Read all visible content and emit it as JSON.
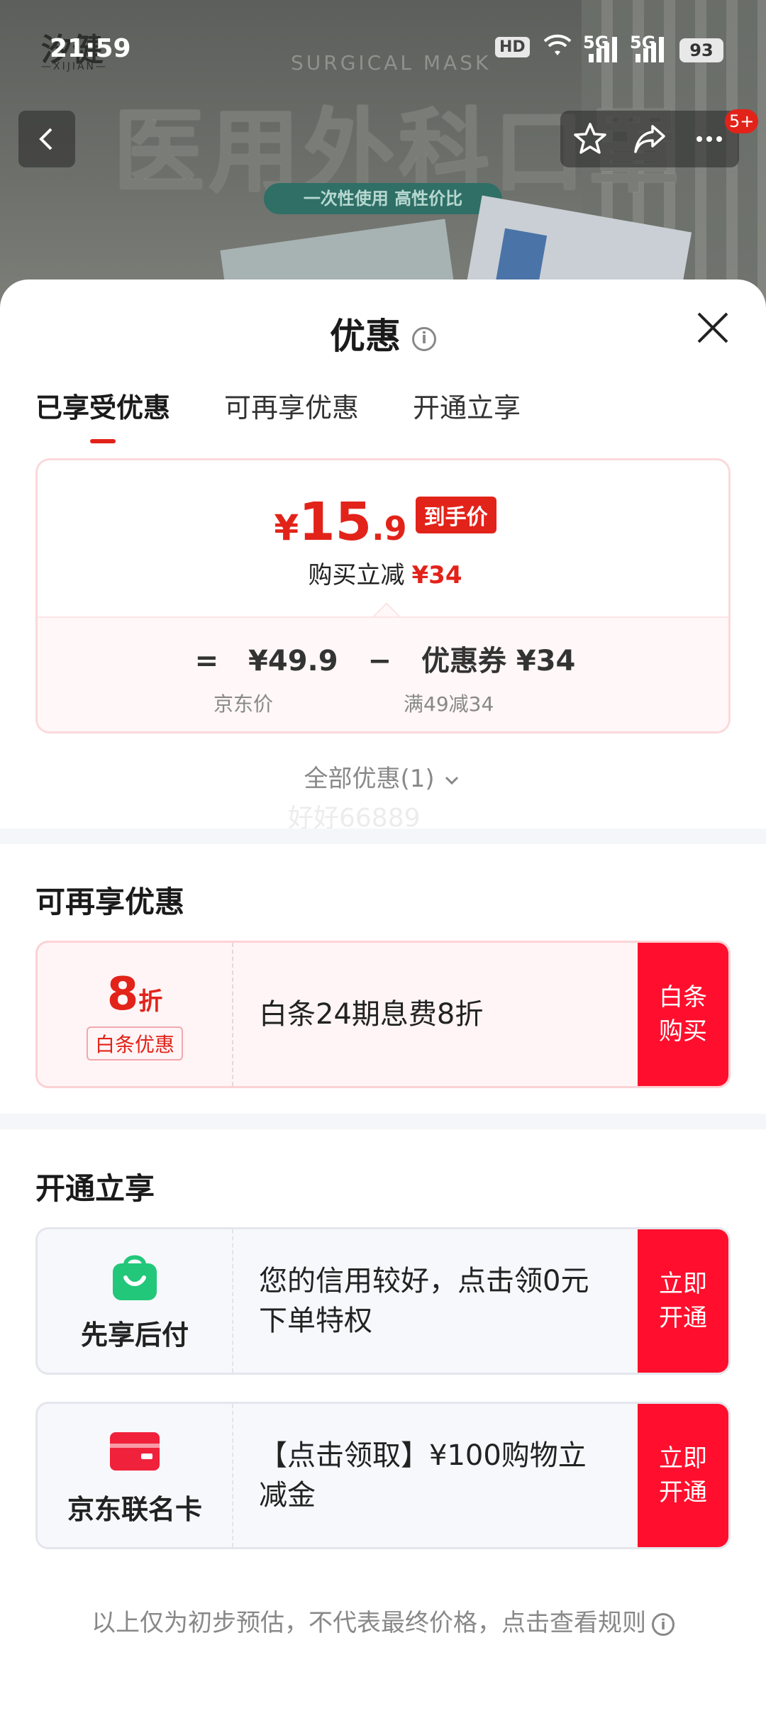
{
  "status_bar": {
    "time": "21:59",
    "hd_label": "HD",
    "signal_1": "5G",
    "signal_2": "5G",
    "battery": "93"
  },
  "banner": {
    "logo": "汐健",
    "logo_sub": "—XIJIAN—",
    "subtitle_en": "SURGICAL MASK",
    "title": "医用外科口罩",
    "pill": "一次性使用 高性价比"
  },
  "nav": {
    "back_icon": "chevron-left-icon",
    "actions": [
      "star-icon",
      "share-icon",
      "more-icon"
    ],
    "badge": "5+"
  },
  "sheet": {
    "title": "优惠",
    "close_icon": "close-icon",
    "tabs": [
      {
        "label": "已享受优惠",
        "active": true
      },
      {
        "label": "可再享优惠",
        "active": false
      },
      {
        "label": "开通立享",
        "active": false
      }
    ],
    "price_card": {
      "currency": "¥",
      "price_int": "15",
      "price_dec": ".9",
      "price_tag": "到手价",
      "sub_label": "购买立减",
      "sub_value": "¥34",
      "eq": "=",
      "jd_price": "¥49.9",
      "minus": "−",
      "coupon": "优惠券 ¥34",
      "jd_price_note": "京东价",
      "coupon_note": "满49减34"
    },
    "all_offers": "全部优惠(1)",
    "watermark": "好好66889",
    "section_more": {
      "title": "可再享优惠",
      "row": {
        "discount_num": "8",
        "discount_unit": "折",
        "tag": "白条优惠",
        "text": "白条24期息费8折",
        "button": "白条购买"
      }
    },
    "section_open": {
      "title": "开通立享",
      "rows": [
        {
          "icon": "shopping-bag-icon",
          "name": "先享后付",
          "text": "您的信用较好，点击领0元下单特权",
          "button": "立即开通"
        },
        {
          "icon": "credit-card-icon",
          "name": "京东联名卡",
          "text": "【点击领取】¥100购物立减金",
          "button": "立即开通"
        }
      ]
    },
    "footer_note": "以上仅为初步预估，不代表最终价格，点击查看规则"
  },
  "colors": {
    "accent_red": "#e2231a",
    "button_red": "#ff0f2d",
    "green_icon": "#22c77a"
  }
}
